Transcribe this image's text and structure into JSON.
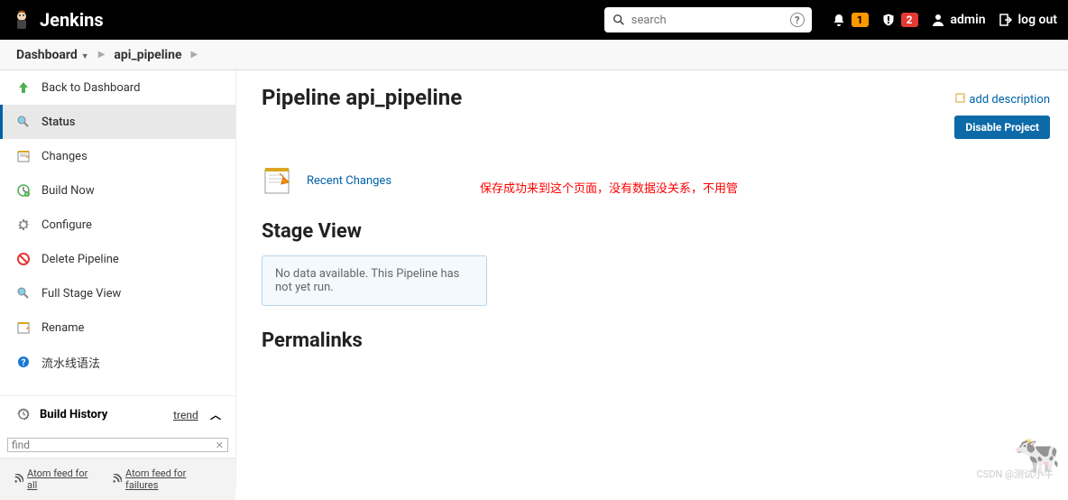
{
  "header": {
    "title": "Jenkins",
    "search_placeholder": "search",
    "notification_count": "1",
    "alert_count": "2",
    "user": "admin",
    "logout": "log out"
  },
  "breadcrumb": {
    "items": [
      "Dashboard",
      "api_pipeline"
    ]
  },
  "sidebar": {
    "items": [
      {
        "label": "Back to Dashboard"
      },
      {
        "label": "Status"
      },
      {
        "label": "Changes"
      },
      {
        "label": "Build Now"
      },
      {
        "label": "Configure"
      },
      {
        "label": "Delete Pipeline"
      },
      {
        "label": "Full Stage View"
      },
      {
        "label": "Rename"
      },
      {
        "label": "流水线语法"
      }
    ],
    "build_history": "Build History",
    "trend": "trend",
    "find_placeholder": "find",
    "rss_all": "Atom feed for all",
    "rss_failures": "Atom feed for failures"
  },
  "main": {
    "title": "Pipeline api_pipeline",
    "add_description": "add description",
    "disable_project": "Disable Project",
    "recent_changes": "Recent Changes",
    "annotation": "保存成功来到这个页面，没有数据没关系，不用管",
    "stage_view_title": "Stage View",
    "no_data": "No data available. This Pipeline has not yet run.",
    "permalinks_title": "Permalinks",
    "watermark": "CSDN @测试小牛"
  }
}
